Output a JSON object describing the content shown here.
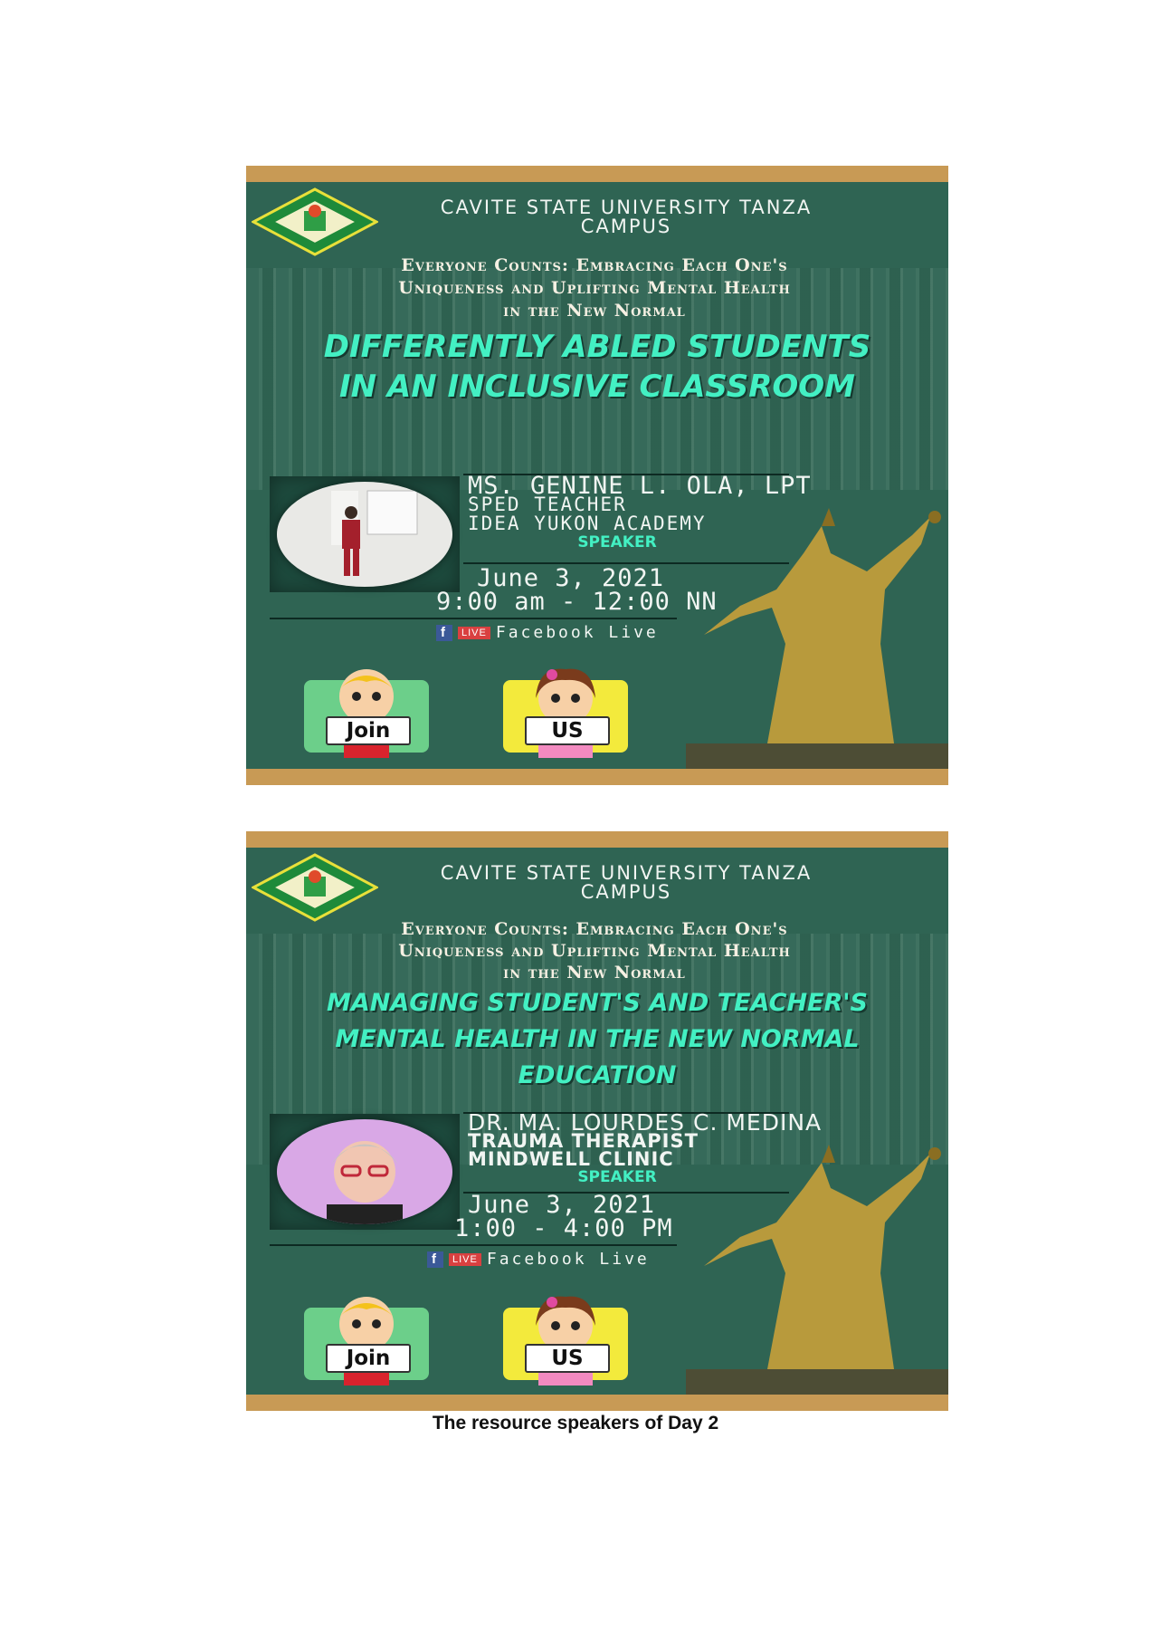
{
  "posters": [
    {
      "campus_line1": "CAVITE STATE UNIVERSITY TANZA",
      "campus_line2": "CAMPUS",
      "theme_line1": "Everyone Counts: Embracing Each One's",
      "theme_line2": "Uniqueness and Uplifting Mental Health",
      "theme_line3": "in the New Normal",
      "title_line1": "DIFFERENTLY ABLED STUDENTS",
      "title_line2": "IN AN INCLUSIVE CLASSROOM",
      "speaker_name": "MS. GENINE L. OLA, LPT",
      "speaker_role": "SPED TEACHER",
      "speaker_org": "IDEA YUKON ACADEMY",
      "speaker_label": "SPEAKER",
      "date": "June 3, 2021",
      "time": "9:00 am - 12:00 NN",
      "fb_icon": "f",
      "live_badge": "LIVE",
      "platform": "Facebook Live",
      "join_label": "Join",
      "us_label": "US"
    },
    {
      "campus_line1": "CAVITE STATE UNIVERSITY TANZA",
      "campus_line2": "CAMPUS",
      "theme_line1": "Everyone Counts: Embracing Each One's",
      "theme_line2": "Uniqueness and Uplifting Mental Health",
      "theme_line3": "in the New Normal",
      "title_line1": "MANAGING STUDENT'S AND TEACHER'S",
      "title_line2": "MENTAL HEALTH IN THE NEW  NORMAL",
      "title_line3": "EDUCATION",
      "speaker_name": "DR. MA. LOURDES C. MEDINA",
      "speaker_role": "TRAUMA THERAPIST",
      "speaker_org": "MINDWELL CLINIC",
      "speaker_label": "SPEAKER",
      "date": "June 3, 2021",
      "time": "1:00 - 4:00 PM",
      "fb_icon": "f",
      "live_badge": "LIVE",
      "platform": "Facebook Live",
      "join_label": "Join",
      "us_label": "US"
    }
  ],
  "caption": "The resource speakers of Day 2",
  "colors": {
    "board": "#2f6453",
    "frame": "#c89a55",
    "accent": "#43f0c3"
  }
}
